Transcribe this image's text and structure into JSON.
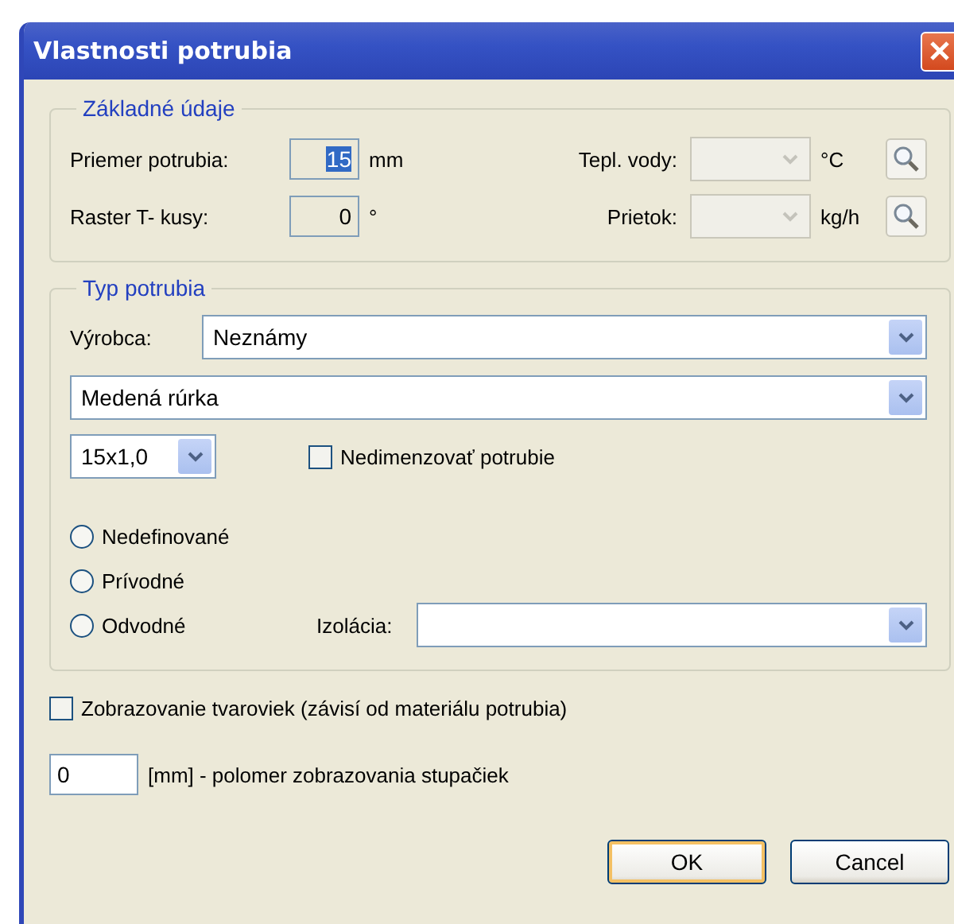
{
  "window": {
    "title": "Vlastnosti potrubia"
  },
  "basic_group": {
    "legend": "Základné údaje",
    "left_rows": [
      {
        "label": "Priemer potrubia:",
        "value": "15",
        "highlighted": true,
        "unit": "mm"
      },
      {
        "label": "Raster T- kusy:",
        "value": "0",
        "highlighted": false,
        "unit": "°"
      }
    ],
    "right_rows": [
      {
        "label": "Tepl. vody:",
        "disabled": true,
        "unit": "°C"
      },
      {
        "label": "Prietok:",
        "disabled": true,
        "unit": "kg/h"
      }
    ]
  },
  "type_group": {
    "legend": "Typ potrubia",
    "manufacturer": {
      "label": "Výrobca:",
      "value": "Neznámy"
    },
    "material": {
      "value": "Medená rúrka"
    },
    "dimension": {
      "value": "15x1,0"
    },
    "no_sizing": {
      "label": "Nedimenzovať potrubie",
      "checked": false
    },
    "radios": [
      {
        "label": "Nedefinované",
        "selected": false
      },
      {
        "label": "Prívodné",
        "selected": false
      },
      {
        "label": "Odvodné",
        "selected": false
      }
    ],
    "insulation": {
      "label": "Izolácia:"
    }
  },
  "fittings": {
    "label": "Zobrazovanie tvaroviek (závisí od materiálu potrubia)",
    "checked": false
  },
  "radius": {
    "value": "0",
    "label": "[mm] - polomer zobrazovania stupačiek"
  },
  "buttons": [
    {
      "label": "OK",
      "default": true
    },
    {
      "label": "Cancel",
      "default": false
    }
  ]
}
